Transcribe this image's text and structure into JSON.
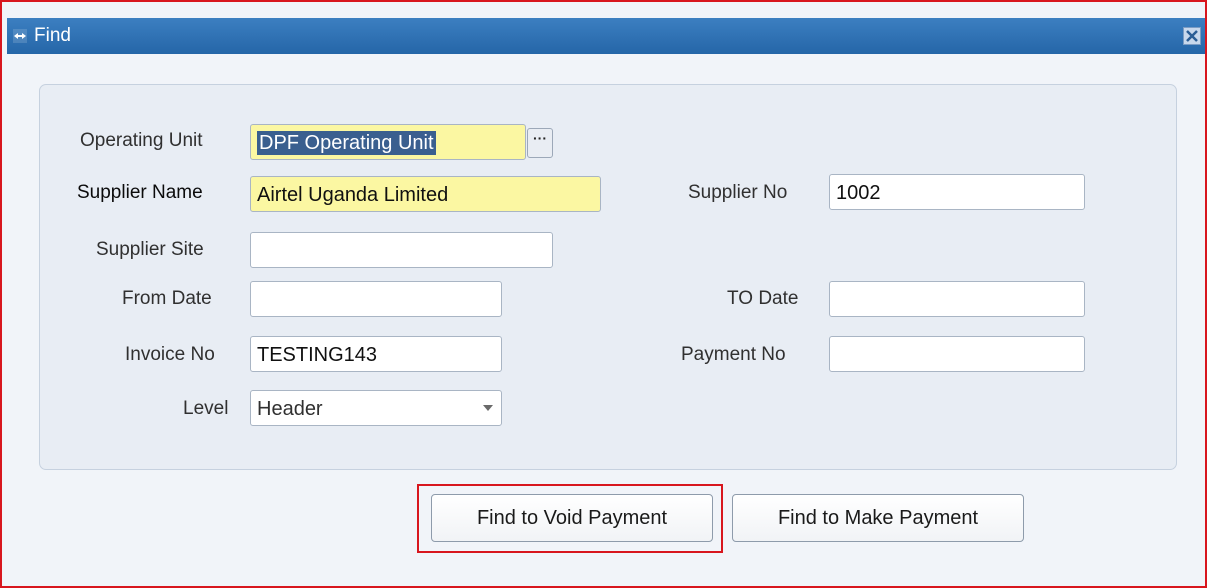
{
  "window": {
    "title": "Find"
  },
  "form": {
    "operating_unit": {
      "label": "Operating Unit",
      "value": "DPF Operating Unit"
    },
    "supplier_name": {
      "label": "Supplier Name",
      "value": "Airtel Uganda Limited"
    },
    "supplier_no": {
      "label": "Supplier No",
      "value": "1002"
    },
    "supplier_site": {
      "label": "Supplier Site",
      "value": ""
    },
    "from_date": {
      "label": "From Date",
      "value": ""
    },
    "to_date": {
      "label": "TO Date",
      "value": ""
    },
    "invoice_no": {
      "label": "Invoice No",
      "value": "TESTING143"
    },
    "payment_no": {
      "label": "Payment No",
      "value": ""
    },
    "level": {
      "label": "Level",
      "value": "Header"
    },
    "lov_button_label": "···"
  },
  "buttons": {
    "find_void": "Find to Void Payment",
    "find_make": "Find to Make Payment"
  },
  "colors": {
    "titlebar": "#2566a8",
    "required_field": "#fbf7a2",
    "highlight": "#d8161e",
    "selection": "#3a5f8f"
  },
  "icons": {
    "title": "find-window-icon",
    "close": "close-icon",
    "lov": "ellipsis-icon",
    "dropdown": "chevron-down-icon"
  }
}
